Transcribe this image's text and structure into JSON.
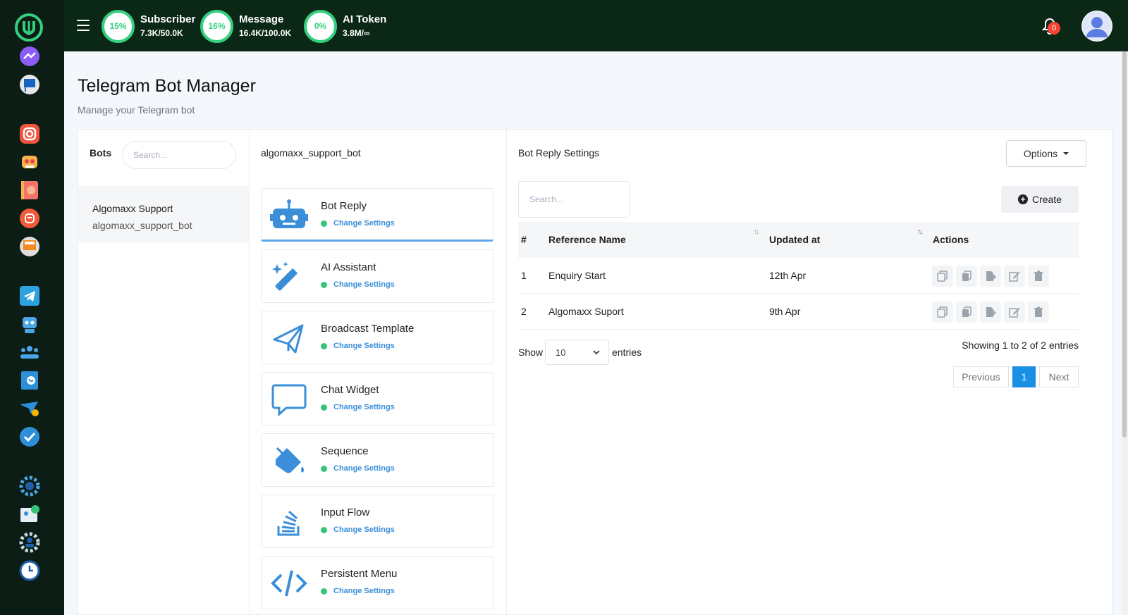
{
  "topbar": {
    "stats": [
      {
        "percent": "15%",
        "title": "Subscriber",
        "value": "7.3K/50.0K"
      },
      {
        "percent": "16%",
        "title": "Message",
        "value": "16.4K/100.0K"
      },
      {
        "percent": "0%",
        "title": "AI Token",
        "value": "3.8M/∞"
      }
    ],
    "notification_count": "0"
  },
  "page": {
    "title": "Telegram Bot Manager",
    "subtitle": "Manage your Telegram bot"
  },
  "bots_panel": {
    "label": "Bots",
    "search_placeholder": "Search...",
    "items": [
      {
        "name": "Algomaxx Support",
        "username": "algomaxx_support_bot"
      }
    ]
  },
  "menu_panel": {
    "label": "algomaxx_support_bot",
    "items": [
      {
        "title": "Bot Reply",
        "link": "Change Settings"
      },
      {
        "title": "AI Assistant",
        "link": "Change Settings"
      },
      {
        "title": "Broadcast Template",
        "link": "Change Settings"
      },
      {
        "title": "Chat Widget",
        "link": "Change Settings"
      },
      {
        "title": "Sequence",
        "link": "Change Settings"
      },
      {
        "title": "Input Flow",
        "link": "Change Settings"
      },
      {
        "title": "Persistent Menu",
        "link": "Change Settings"
      }
    ]
  },
  "main_panel": {
    "label": "Bot Reply Settings",
    "options_label": "Options",
    "search_placeholder": "Search...",
    "create_label": "Create",
    "table": {
      "headers": [
        "#",
        "Reference Name",
        "Updated at",
        "Actions"
      ],
      "rows": [
        {
          "num": "1",
          "name": "Enquiry Start",
          "updated": "12th Apr"
        },
        {
          "num": "2",
          "name": "Algomaxx Suport",
          "updated": "9th Apr"
        }
      ]
    },
    "footer": {
      "show_label": "Show",
      "show_value": "10",
      "entries_label": "entries",
      "showing_text": "Showing 1 to 2 of 2 entries",
      "prev_label": "Previous",
      "page": "1",
      "next_label": "Next"
    }
  },
  "colors": {
    "sidebar_bg": "#0b1d14",
    "topbar_bg": "#0b2817",
    "ring": "#35d07f",
    "link": "#3a8fd8",
    "status_dot": "#35c47a",
    "page_active": "#1a8fe6"
  }
}
